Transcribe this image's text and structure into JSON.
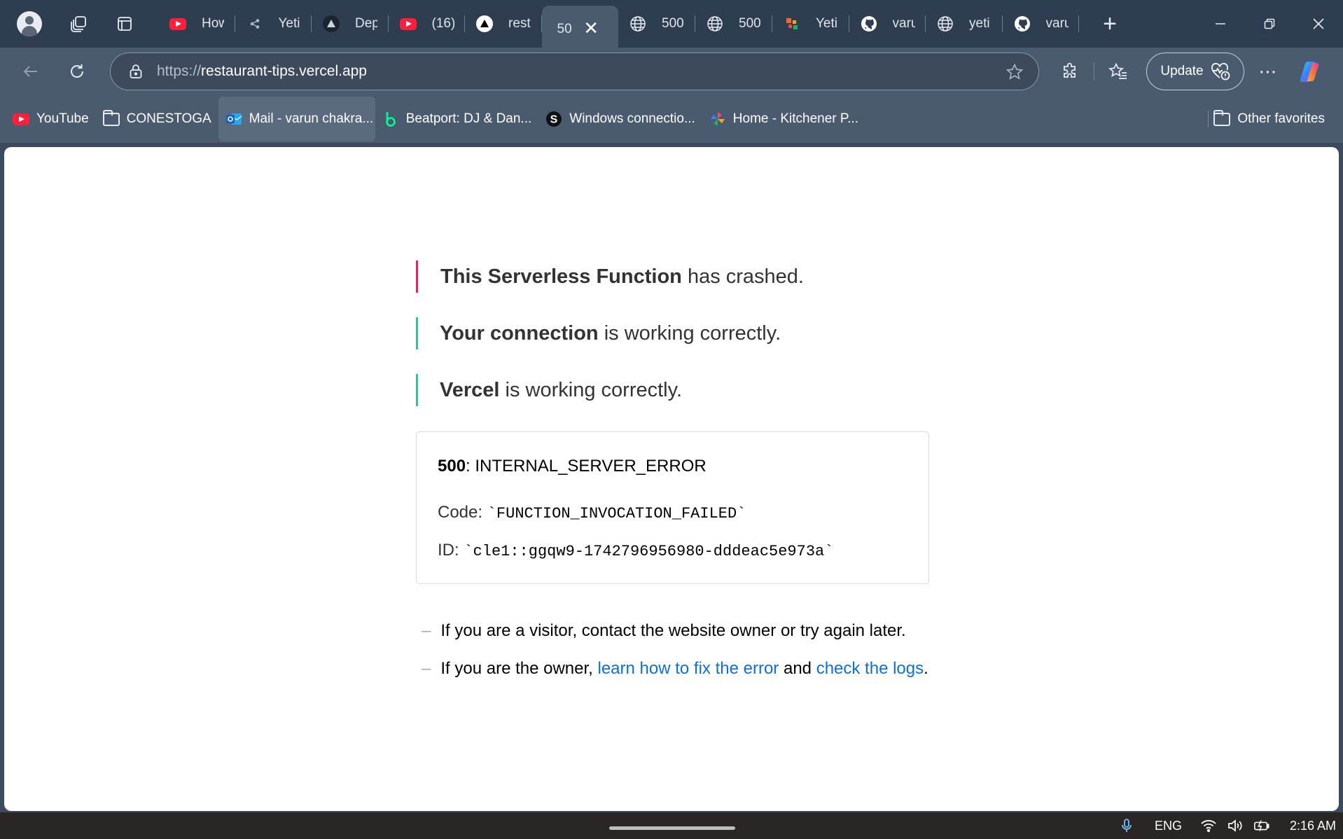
{
  "browser": {
    "tabs": [
      {
        "label": "How",
        "icon": "youtube-icon"
      },
      {
        "label": "Yeti",
        "icon": "share-icon"
      },
      {
        "label": "Dep",
        "icon": "vercel-icon"
      },
      {
        "label": "(16)",
        "icon": "youtube-icon"
      },
      {
        "label": "rest",
        "icon": "vercel-icon"
      },
      {
        "label": "50",
        "icon": "none",
        "active": true
      },
      {
        "label": "500",
        "icon": "globe-icon"
      },
      {
        "label": "500",
        "icon": "globe-icon"
      },
      {
        "label": "Yeti",
        "icon": "app-icon"
      },
      {
        "label": "varu",
        "icon": "github-icon"
      },
      {
        "label": "yeti",
        "icon": "globe-icon"
      },
      {
        "label": "varu",
        "icon": "github-icon"
      }
    ],
    "url": {
      "scheme": "https://",
      "host": "restaurant-tips.vercel.app"
    },
    "update_label": "Update",
    "bookmarks": [
      {
        "label": "YouTube",
        "icon": "youtube-icon"
      },
      {
        "label": "CONESTOGA",
        "icon": "folder-icon"
      },
      {
        "label": "Mail - varun chakra...",
        "icon": "outlook-icon"
      },
      {
        "label": "Beatport: DJ & Dan...",
        "icon": "beatport-icon"
      },
      {
        "label": "Windows connectio...",
        "icon": "s-icon"
      },
      {
        "label": "Home - Kitchener P...",
        "icon": "pinwheel-icon"
      }
    ],
    "other_favorites": "Other favorites"
  },
  "page": {
    "lines": [
      {
        "bold": "This Serverless Function",
        "rest": " has crashed."
      },
      {
        "bold": "Your connection",
        "rest": " is working correctly."
      },
      {
        "bold": "Vercel",
        "rest": " is working correctly."
      }
    ],
    "error": {
      "status_code": "500",
      "status_text": ": INTERNAL_SERVER_ERROR",
      "code_label": "Code: ",
      "code_value": "`FUNCTION_INVOCATION_FAILED`",
      "id_label": "ID: ",
      "id_value": "`cle1::ggqw9-1742796956980-dddeac5e973a`"
    },
    "visitor_text": "If you are a visitor, contact the website owner or try again later.",
    "owner_prefix": "If you are the owner, ",
    "owner_link1": "learn how to fix the error",
    "owner_mid": " and ",
    "owner_link2": "check the logs",
    "owner_suffix": "."
  },
  "taskbar": {
    "language": "ENG",
    "time": "2:16 AM"
  },
  "colors": {
    "crash_accent": "#e5235f",
    "ok_accent": "#3ebca2",
    "link": "#0a70e0"
  }
}
